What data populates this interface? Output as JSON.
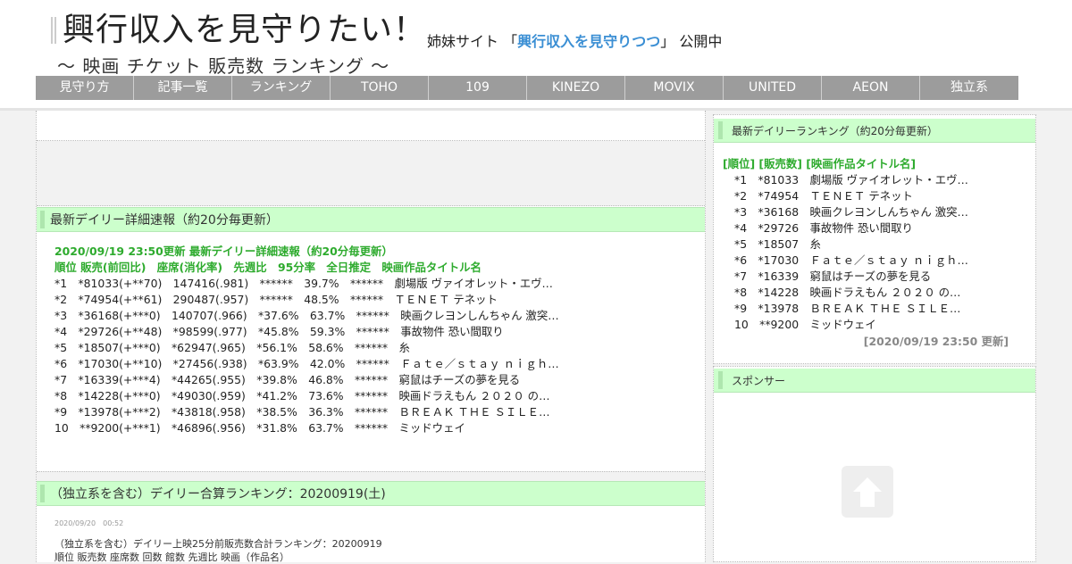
{
  "header": {
    "title": "興行収入を見守りたい！",
    "sister_prefix": "姉妹サイト 「",
    "sister_link": "興行収入を見守りつつ",
    "sister_suffix": "」 公開中",
    "subtitle": "～ 映画 チケット 販売数 ランキング ～"
  },
  "nav": [
    "見守り方",
    "記事一覧",
    "ランキング",
    "TOHO",
    "109",
    "KINEZO",
    "MOVIX",
    "UNITED",
    "AEON",
    "独立系"
  ],
  "main": {
    "detail_title": "最新デイリー詳細速報（約20分毎更新）",
    "detail_update": "2020/09/19 23:50更新 最新デイリー詳細速報（約20分毎更新）",
    "detail_columns": "順位 販売(前回比)　座席(消化率)　先週比　95分率　全日推定　映画作品タイトル名",
    "detail_rows": [
      "*1　*81033(+**70)　147416(.981)　******　39.7%　******　劇場版 ヴァイオレット・エヴ…",
      "*2　*74954(+**61)　290487(.957)　******　48.5%　******　ＴＥＮＥＴ テネット",
      "*3　*36168(+***0)　140707(.966)　*37.6%　63.7%　******　映画クレヨンしんちゃん 激突…",
      "*4　*29726(+**48)　*98599(.977)　*45.8%　59.3%　******　事故物件 恐い間取り",
      "*5　*18507(+***0)　*62947(.965)　*56.1%　58.6%　******　糸",
      "*6　*17030(+**10)　*27456(.938)　*63.9%　42.0%　******　Ｆａｔｅ／ｓｔａｙ ｎｉｇｈ…",
      "*7　*16339(+***4)　*44265(.955)　*39.8%　46.8%　******　窮鼠はチーズの夢を見る",
      "*8　*14228(+***0)　*49030(.959)　*41.2%　73.6%　******　映画ドラえもん ２０２０ の…",
      "*9　*13978(+***2)　*43818(.958)　*38.5%　36.3%　******　ＢＲＥＡＫ ＴＨＥ ＳＩＬＥ…",
      "10　**9200(+***1)　*46896(.956)　*31.8%　63.7%　******　ミッドウェイ"
    ],
    "combined_title": "（独立系を含む）デイリー合算ランキング：20200919(土)",
    "combined_date": "2020/09/20　00:52",
    "combined_line1": "（独立系を含む）デイリー上映25分前販売数合計ランキング：20200919",
    "combined_line2": "順位 販売数 座席数 回数 館数 先週比 映画（作品名）"
  },
  "sidebar": {
    "ranking_title": "最新デイリーランキング（約20分毎更新）",
    "ranking_header": "[順位] [販売数] [映画作品タイトル名]",
    "ranking_rows": [
      "*1　*81033　劇場版 ヴァイオレット・エヴ…",
      "*2　*74954　ＴＥＮＥＴ テネット",
      "*3　*36168　映画クレヨンしんちゃん 激突…",
      "*4　*29726　事故物件 恐い間取り",
      "*5　*18507　糸",
      "*6　*17030　Ｆａｔｅ／ｓｔａｙ ｎｉｇｈ…",
      "*7　*16339　窮鼠はチーズの夢を見る",
      "*8　*14228　映画ドラえもん ２０２０ の…",
      "*9　*13978　ＢＲＥＡＫ ＴＨＥ ＳＩＬＥ…",
      "10　**9200　ミッドウェイ"
    ],
    "ranking_updated": "[2020/09/19 23:50 更新]",
    "sponsor_title": "スポンサー",
    "totop_icon": "arrow-up-icon"
  },
  "colors": {
    "section_bg": "#ccffcc",
    "green_text": "#2eab2e",
    "link": "#3b8fd4",
    "nav_bg": "#9c9c9c"
  }
}
